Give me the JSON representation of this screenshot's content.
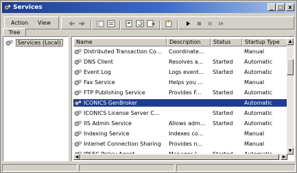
{
  "window": {
    "title": "Services",
    "controls": {
      "minimize": "_",
      "maximize": "□",
      "close": "x"
    }
  },
  "toolbar": {
    "action_label": "Action",
    "view_label": "View",
    "icons": [
      "back-icon",
      "forward-icon",
      "up-icon",
      "show-hide-tree-icon",
      "properties-icon",
      "refresh-icon",
      "export-list-icon",
      "help-icon",
      "start-service-icon",
      "stop-service-icon",
      "pause-service-icon",
      "restart-service-icon"
    ]
  },
  "tree": {
    "tab_label": "Tree",
    "root_label": "Services (Local)"
  },
  "list": {
    "columns": [
      "Name",
      "Description",
      "Status",
      "Startup Type"
    ],
    "rows": [
      {
        "name": "Distributed Transaction Co...",
        "description": "Coordinate...",
        "status": "",
        "startup": "Manual",
        "selected": false
      },
      {
        "name": "DNS Client",
        "description": "Resolves a...",
        "status": "Started",
        "startup": "Automatic",
        "selected": false
      },
      {
        "name": "Event Log",
        "description": "Logs event...",
        "status": "Started",
        "startup": "Automatic",
        "selected": false
      },
      {
        "name": "Fax Service",
        "description": "Helps you ...",
        "status": "",
        "startup": "Manual",
        "selected": false
      },
      {
        "name": "FTP Publishing Service",
        "description": "Provides F...",
        "status": "Started",
        "startup": "Automatic",
        "selected": false
      },
      {
        "name": "ICONICS GenBroker",
        "description": "",
        "status": "",
        "startup": "Automatic",
        "selected": true
      },
      {
        "name": "ICONICS License Server C...",
        "description": "",
        "status": "Started",
        "startup": "Automatic",
        "selected": false
      },
      {
        "name": "IIS Admin Service",
        "description": "Allows adm...",
        "status": "Started",
        "startup": "Automatic",
        "selected": false
      },
      {
        "name": "Indexing Service",
        "description": "Indexes co...",
        "status": "",
        "startup": "Manual",
        "selected": false
      },
      {
        "name": "Internet Connection Sharing",
        "description": "Provides n...",
        "status": "",
        "startup": "Manual",
        "selected": false
      },
      {
        "name": "IPSEC Policy Agent",
        "description": "Manages I...",
        "status": "Started",
        "startup": "Automatic",
        "selected": false
      }
    ]
  },
  "colors": {
    "title_start": "#1f3d8f",
    "title_end": "#a9c2ea",
    "selection": "#1f3d8f",
    "chrome": "#d4d0c8"
  }
}
